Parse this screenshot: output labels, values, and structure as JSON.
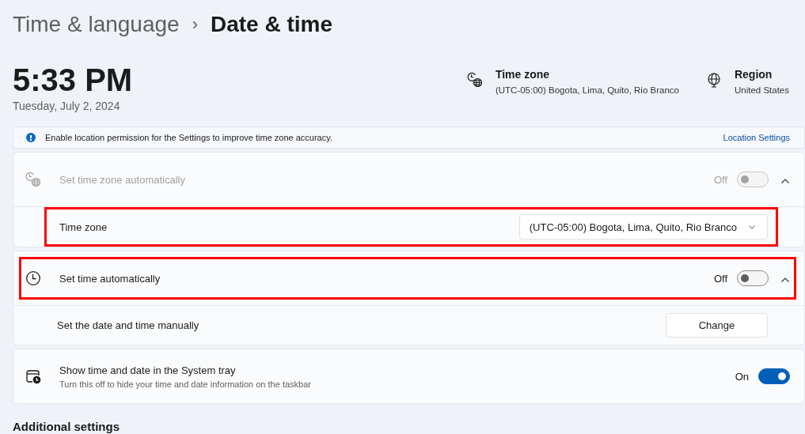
{
  "breadcrumb": {
    "parent": "Time & language",
    "separator": "›",
    "current": "Date & time"
  },
  "clock": {
    "time": "5:33 PM",
    "date": "Tuesday, July 2, 2024"
  },
  "summary": [
    {
      "label": "Time zone",
      "value": "(UTC-05:00) Bogota, Lima, Quito, Rio Branco"
    },
    {
      "label": "Region",
      "value": "United States"
    }
  ],
  "notice": {
    "text": "Enable location permission for the Settings to improve time zone accuracy.",
    "link": "Location Settings"
  },
  "cards": [
    {
      "rows": [
        {
          "kind": "toggle",
          "label": "Set time zone automatically",
          "disabled": true,
          "on": false,
          "state_text": "Off",
          "expanded": true,
          "highlighted": false
        },
        {
          "kind": "dropdown",
          "label": "Time zone",
          "value": "(UTC-05:00) Bogota, Lima, Quito, Rio Branco",
          "highlighted": true
        }
      ]
    },
    {
      "rows": [
        {
          "kind": "toggle",
          "label": "Set time automatically",
          "disabled": false,
          "on": false,
          "state_text": "Off",
          "expanded": true,
          "highlighted": true
        },
        {
          "kind": "button",
          "label": "Set the date and time manually",
          "button": "Change",
          "highlighted": false
        }
      ]
    },
    {
      "rows": [
        {
          "kind": "toggle",
          "label": "Show time and date in the System tray",
          "description": "Turn this off to hide your time and date information on the taskbar",
          "disabled": false,
          "on": true,
          "state_text": "On",
          "highlighted": false
        }
      ]
    }
  ],
  "section_heading": "Additional settings"
}
